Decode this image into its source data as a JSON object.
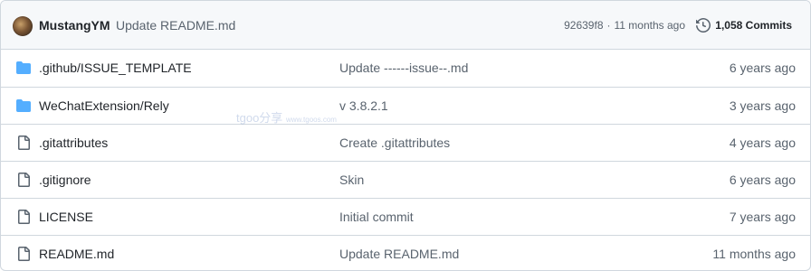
{
  "latest_commit": {
    "author": "MustangYM",
    "message": "Update README.md",
    "hash": "92639f8",
    "separator": "·",
    "time": "11 months ago",
    "commits_label": "1,058 Commits"
  },
  "files": [
    {
      "type": "folder",
      "name": ".github/ISSUE_TEMPLATE",
      "message": "Update ------issue--.md",
      "age": "6 years ago"
    },
    {
      "type": "folder",
      "name": "WeChatExtension/Rely",
      "message": "v 3.8.2.1",
      "age": "3 years ago"
    },
    {
      "type": "file",
      "name": ".gitattributes",
      "message": "Create .gitattributes",
      "age": "4 years ago"
    },
    {
      "type": "file",
      "name": ".gitignore",
      "message": "Skin",
      "age": "6 years ago"
    },
    {
      "type": "file",
      "name": "LICENSE",
      "message": "Initial commit",
      "age": "7 years ago"
    },
    {
      "type": "file",
      "name": "README.md",
      "message": "Update README.md",
      "age": "11 months ago"
    }
  ],
  "watermark": {
    "text": "tgoo分享",
    "url": "www.tgoos.com"
  },
  "colors": {
    "folder": "#54aeff",
    "file": "#59636e",
    "border": "#d0d7de",
    "header_bg": "#f6f8fa"
  }
}
